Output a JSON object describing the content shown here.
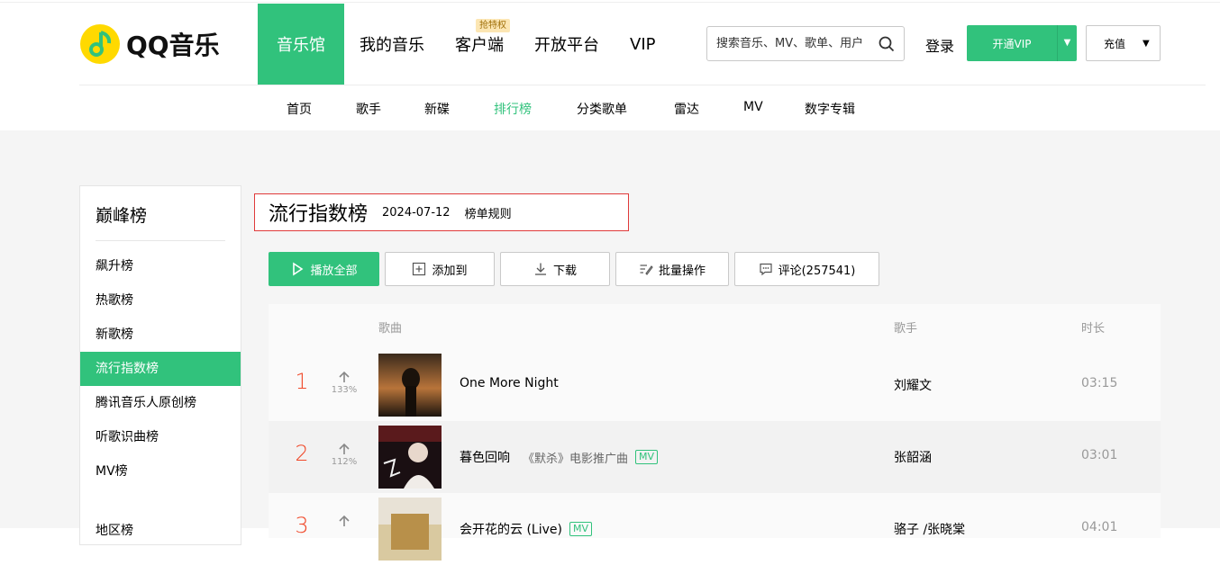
{
  "brand": {
    "name": "QQ音乐"
  },
  "nav": {
    "items": [
      {
        "label": "音乐馆",
        "active": true
      },
      {
        "label": "我的音乐"
      },
      {
        "label": "客户端",
        "badge": "抢特权"
      },
      {
        "label": "开放平台"
      },
      {
        "label": "VIP"
      }
    ]
  },
  "search": {
    "placeholder": "搜索音乐、MV、歌单、用户",
    "icon": "search-icon"
  },
  "header": {
    "login_label": "登录",
    "vip_label": "开通VIP",
    "recharge_label": "充值"
  },
  "subnav": {
    "items": [
      {
        "label": "首页"
      },
      {
        "label": "歌手"
      },
      {
        "label": "新碟"
      },
      {
        "label": "排行榜",
        "active": true
      },
      {
        "label": "分类歌单"
      },
      {
        "label": "雷达"
      },
      {
        "label": "MV"
      },
      {
        "label": "数字专辑"
      }
    ]
  },
  "sidebar": {
    "title": "巅峰榜",
    "items": [
      {
        "label": "飙升榜"
      },
      {
        "label": "热歌榜"
      },
      {
        "label": "新歌榜"
      },
      {
        "label": "流行指数榜",
        "active": true
      },
      {
        "label": "腾讯音乐人原创榜"
      },
      {
        "label": "听歌识曲榜"
      },
      {
        "label": "MV榜"
      },
      {
        "label": "地区榜"
      }
    ]
  },
  "chart_header": {
    "title": "流行指数榜",
    "date": "2024-07-12",
    "rules_label": "榜单规则"
  },
  "actions": {
    "play_all": "播放全部",
    "add_to": "添加到",
    "download": "下载",
    "batch": "批量操作",
    "comments": "评论(257541)"
  },
  "table": {
    "headers": {
      "song": "歌曲",
      "artist": "歌手",
      "duration": "时长"
    },
    "rows": [
      {
        "rank": "1",
        "trend": "133%",
        "title": "One More Night",
        "subtitle": "",
        "mv": "",
        "artist": "刘耀文",
        "duration": "03:15"
      },
      {
        "rank": "2",
        "trend": "112%",
        "title": "暮色回响",
        "subtitle": "《默杀》电影推广曲",
        "mv": "MV",
        "artist": "张韶涵",
        "duration": "03:01"
      },
      {
        "rank": "3",
        "trend": "",
        "title": "会开花的云 (Live)",
        "subtitle": "",
        "mv": "MV",
        "artist": "骆子 /张晓棠",
        "duration": "04:01"
      }
    ]
  },
  "colors": {
    "accent": "#31c27c",
    "rank": "#f04a2b",
    "highlight_border": "#e03a3a"
  }
}
